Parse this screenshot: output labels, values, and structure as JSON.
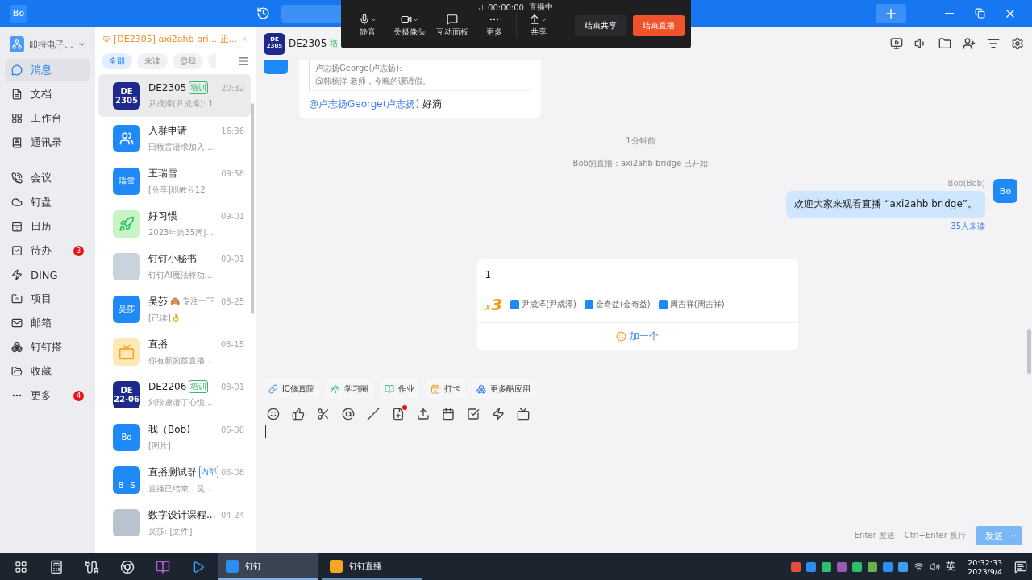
{
  "title_bar": {
    "logo": "Bo"
  },
  "live_toolbar": {
    "timer": "00:00:00",
    "status": "直播中",
    "controls": [
      {
        "label": "静音",
        "kind": "mic",
        "dropdown": true
      },
      {
        "label": "关摄像头",
        "kind": "camera",
        "dropdown": true
      },
      {
        "label": "互动面板",
        "kind": "panel",
        "dropdown": false
      },
      {
        "label": "更多",
        "kind": "more",
        "dropdown": false
      },
      {
        "label": "共享",
        "kind": "share",
        "dropdown": true
      }
    ],
    "buttons": [
      {
        "label": "结束共享",
        "kind": "secondary"
      },
      {
        "label": "结束直播",
        "kind": "danger"
      }
    ]
  },
  "org": {
    "name": "叩持电子..."
  },
  "nav": [
    {
      "label": "消息",
      "selected": true
    },
    {
      "label": "文档",
      "selected": false
    },
    {
      "label": "工作台",
      "selected": false
    },
    {
      "label": "通讯录",
      "selected": false
    },
    {
      "label": "会议",
      "selected": false
    },
    {
      "label": "钉盘",
      "selected": false
    },
    {
      "label": "日历",
      "selected": false
    },
    {
      "label": "待办",
      "selected": false,
      "badge": "3"
    },
    {
      "label": "DING",
      "selected": false
    },
    {
      "label": "项目",
      "selected": false
    },
    {
      "label": "邮箱",
      "selected": false
    },
    {
      "label": "钉钉搭",
      "selected": false
    },
    {
      "label": "收藏",
      "selected": false
    },
    {
      "label": "更多",
      "selected": false,
      "badge": "4"
    }
  ],
  "live_banner": {
    "text": "[DE2305] axi2ahb bri... 正..."
  },
  "filters": [
    {
      "label": "全部",
      "selected": true
    },
    {
      "label": "未读",
      "selected": false
    },
    {
      "label": "@我",
      "selected": false
    }
  ],
  "conversations": [
    {
      "name": "DE2305",
      "tag": {
        "text": "培训",
        "color": "#34b96a"
      },
      "time": "20:32",
      "preview": "尹成泽(尹成泽): 1",
      "kind": "badge",
      "avatar_text": [
        "DE",
        "2305"
      ],
      "selected": true
    },
    {
      "name": "入群申请",
      "time": "16:36",
      "preview": "田牧言请求加入 ...",
      "kind": "users",
      "selected": false
    },
    {
      "name": "王瑞雪",
      "time": "09:58",
      "preview": "[分享]职教云12",
      "kind": "text",
      "avatar_text": [
        "瑞雪"
      ],
      "selected": false
    },
    {
      "name": "好习惯",
      "time": "09-01",
      "preview": "2023年第35周|...",
      "kind": "rocket",
      "selected": false
    },
    {
      "name": "钉钉小秘书",
      "time": "09-01",
      "preview": "钉钉AI魔法棒功...",
      "kind": "photo",
      "selected": false
    },
    {
      "name": "吴莎",
      "status": "🙈 专注一下",
      "time": "08-25",
      "preview": "[已读]👌",
      "kind": "text",
      "avatar_text": [
        "吴莎"
      ],
      "selected": false
    },
    {
      "name": "直播",
      "time": "08-15",
      "preview": "你有新的群直播...",
      "kind": "live",
      "selected": false
    },
    {
      "name": "DE2206",
      "tag": {
        "text": "培训",
        "color": "#34b96a"
      },
      "time": "08-01",
      "preview": "刘珍邀请丁心悦...",
      "kind": "badge",
      "avatar_text": [
        "DE",
        "22-06"
      ],
      "selected": false
    },
    {
      "name": "我（Bob)",
      "time": "06-08",
      "preview": "[图片]",
      "kind": "text",
      "avatar_text": [
        "Bo"
      ],
      "selected": false
    },
    {
      "name": "直播测试群",
      "tag": {
        "text": "内部",
        "color": "#3b7ff0"
      },
      "time": "06-08",
      "preview": "直播已结束，吴...",
      "kind": "tiles",
      "avatar_text": [
        "B",
        "S"
      ],
      "selected": false
    },
    {
      "name": "数字设计课程...",
      "time": "04-24",
      "preview": "吴莎: [文件]",
      "kind": "collage",
      "selected": false
    }
  ],
  "chat": {
    "avatar_text": [
      "DE",
      "2305"
    ],
    "title": "DE2305",
    "tag": "培",
    "quote_author": "卢志扬George(卢志扬):",
    "quote_text": "@韩杨洋 老师，今晚的课请假。",
    "reply_mention": "@卢志扬George(卢志扬)",
    "reply_text": "好滴",
    "timestamp": "1分钟前",
    "system": "Bob的直播：axi2ahb bridge 已开始",
    "own_message": {
      "sender": "Bob(Bob)",
      "text": "欢迎大家来观看直播 “axi2ahb bridge”。",
      "unread": "35人未读",
      "avatar": "Bo"
    },
    "plus_one": {
      "text": "1",
      "count_prefix": "x",
      "count": "3",
      "people": [
        "尹成泽(尹成泽)",
        "金奇益(金奇益)",
        "周吉祥(周吉祥)"
      ],
      "action": "加一个"
    },
    "apps": [
      {
        "label": "IC修真院",
        "kind": "link"
      },
      {
        "label": "学习圈",
        "kind": "circle"
      },
      {
        "label": "作业",
        "kind": "homework"
      },
      {
        "label": "打卡",
        "kind": "checkin"
      },
      {
        "label": "更多酷应用",
        "kind": "more"
      }
    ],
    "hint_send": "Enter 发送",
    "hint_newline": "Ctrl+Enter 换行",
    "send": "发送"
  },
  "taskbar": {
    "apps": [
      {
        "label": "钉钉",
        "selected": true
      },
      {
        "label": "钉钉直播",
        "selected": false
      }
    ],
    "ime": "英",
    "time": "20:32:33",
    "date": "2023/9/4"
  }
}
